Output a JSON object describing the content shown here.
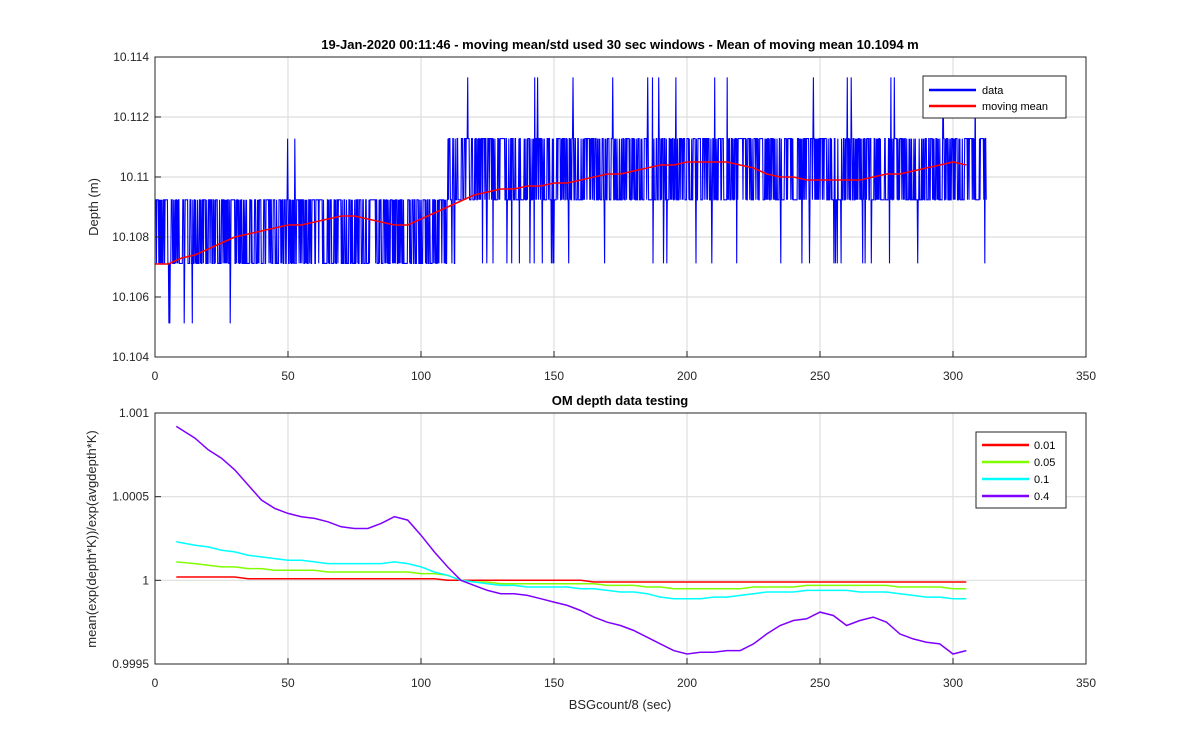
{
  "chart_data": [
    {
      "type": "line",
      "title": "19-Jan-2020 00:11:46 - moving mean/std used 30 sec windows - Mean of moving mean 10.1094 m",
      "xlabel": "",
      "ylabel": "Depth (m)",
      "xlim": [
        0,
        350
      ],
      "ylim": [
        10.104,
        10.114
      ],
      "xticks": [
        "0",
        "50",
        "100",
        "150",
        "200",
        "250",
        "300",
        "350"
      ],
      "yticks": [
        "10.104",
        "10.106",
        "10.108",
        "10.11",
        "10.112",
        "10.114"
      ],
      "grid": true,
      "legend_position": "top-right",
      "series": [
        {
          "name": "data",
          "color": "#0000ff",
          "style": "noisy",
          "x_range": [
            0,
            312.5
          ],
          "levels": [
            10.10512,
            10.10712,
            10.10924,
            10.11128,
            10.11332
          ],
          "note_levels_by_segment": [
            {
              "x": [
                0,
                30
              ],
              "low": 10.10712,
              "high": 10.10924,
              "dips_to": 10.10512
            },
            {
              "x": [
                30,
                110
              ],
              "low": 10.10712,
              "high": 10.10924,
              "spikes_to": 10.11128
            },
            {
              "x": [
                110,
                312.5
              ],
              "low": 10.10924,
              "high": 10.11128,
              "dips_to": 10.10712,
              "spikes_to": 10.11332
            }
          ]
        },
        {
          "name": "moving mean",
          "color": "#ff0000",
          "x": [
            0,
            5,
            10,
            15,
            20,
            25,
            30,
            35,
            40,
            45,
            50,
            55,
            60,
            65,
            70,
            75,
            80,
            85,
            90,
            95,
            100,
            105,
            110,
            115,
            120,
            125,
            130,
            135,
            140,
            145,
            150,
            155,
            160,
            165,
            170,
            175,
            180,
            185,
            190,
            195,
            200,
            205,
            210,
            215,
            220,
            225,
            230,
            235,
            240,
            245,
            250,
            255,
            260,
            265,
            270,
            275,
            280,
            285,
            290,
            295,
            300,
            305
          ],
          "values": [
            10.1071,
            10.1071,
            10.1073,
            10.1074,
            10.1076,
            10.1078,
            10.108,
            10.1081,
            10.1082,
            10.1083,
            10.1084,
            10.1084,
            10.1085,
            10.1086,
            10.1087,
            10.1087,
            10.1086,
            10.1085,
            10.1084,
            10.1084,
            10.1086,
            10.1088,
            10.109,
            10.1092,
            10.1094,
            10.1095,
            10.1096,
            10.1096,
            10.1097,
            10.1097,
            10.1098,
            10.1098,
            10.1099,
            10.11,
            10.1101,
            10.1101,
            10.1102,
            10.1103,
            10.1104,
            10.1104,
            10.1105,
            10.1105,
            10.1105,
            10.1105,
            10.1104,
            10.1103,
            10.1101,
            10.11,
            10.11,
            10.1099,
            10.1099,
            10.1099,
            10.1099,
            10.1099,
            10.11,
            10.1101,
            10.1101,
            10.1102,
            10.1103,
            10.1104,
            10.1105,
            10.1104
          ]
        }
      ]
    },
    {
      "type": "line",
      "title": "OM depth data testing",
      "xlabel": "BSGcount/8 (sec)",
      "ylabel": "mean(exp(depth*K))/exp(avgdepth*K)",
      "xlim": [
        0,
        350
      ],
      "ylim": [
        0.9995,
        1.001
      ],
      "xticks": [
        "0",
        "50",
        "100",
        "150",
        "200",
        "250",
        "300",
        "350"
      ],
      "yticks": [
        "0.9995",
        "1",
        "1.0005",
        "1.001"
      ],
      "grid": true,
      "legend_position": "top-right",
      "x": [
        8,
        15,
        20,
        25,
        30,
        35,
        40,
        45,
        50,
        55,
        60,
        65,
        70,
        75,
        80,
        85,
        90,
        95,
        100,
        105,
        110,
        115,
        120,
        125,
        130,
        135,
        140,
        145,
        150,
        155,
        160,
        165,
        170,
        175,
        180,
        185,
        190,
        195,
        200,
        205,
        210,
        215,
        220,
        225,
        230,
        235,
        240,
        245,
        250,
        255,
        260,
        265,
        270,
        275,
        280,
        285,
        290,
        295,
        300,
        305
      ],
      "series": [
        {
          "name": "0.01",
          "color": "#ff0000",
          "values": [
            1.00002,
            1.00002,
            1.00002,
            1.00002,
            1.00002,
            1.00001,
            1.00001,
            1.00001,
            1.00001,
            1.00001,
            1.00001,
            1.00001,
            1.00001,
            1.00001,
            1.00001,
            1.00001,
            1.00001,
            1.00001,
            1.00001,
            1.00001,
            1.0,
            1.0,
            1.0,
            1.0,
            1.0,
            1.0,
            1.0,
            1.0,
            1.0,
            1.0,
            1.0,
            0.99999,
            0.99999,
            0.99999,
            0.99999,
            0.99999,
            0.99999,
            0.99999,
            0.99999,
            0.99999,
            0.99999,
            0.99999,
            0.99999,
            0.99999,
            0.99999,
            0.99999,
            0.99999,
            0.99999,
            0.99999,
            0.99999,
            0.99999,
            0.99999,
            0.99999,
            0.99999,
            0.99999,
            0.99999,
            0.99999,
            0.99999,
            0.99999,
            0.99999
          ]
        },
        {
          "name": "0.05",
          "color": "#80ff00",
          "values": [
            1.00011,
            1.0001,
            1.00009,
            1.00008,
            1.00008,
            1.00007,
            1.00007,
            1.00006,
            1.00006,
            1.00006,
            1.00006,
            1.00005,
            1.00005,
            1.00005,
            1.00005,
            1.00005,
            1.00005,
            1.00005,
            1.00004,
            1.00004,
            1.00003,
            1.0,
            0.99999,
            0.99999,
            0.99998,
            0.99998,
            0.99998,
            0.99998,
            0.99998,
            0.99998,
            0.99998,
            0.99998,
            0.99997,
            0.99997,
            0.99997,
            0.99996,
            0.99996,
            0.99995,
            0.99995,
            0.99995,
            0.99995,
            0.99995,
            0.99995,
            0.99996,
            0.99996,
            0.99996,
            0.99996,
            0.99997,
            0.99997,
            0.99997,
            0.99997,
            0.99997,
            0.99997,
            0.99997,
            0.99996,
            0.99996,
            0.99996,
            0.99996,
            0.99995,
            0.99995
          ]
        },
        {
          "name": "0.1",
          "color": "#00ffff",
          "values": [
            1.00023,
            1.00021,
            1.0002,
            1.00018,
            1.00017,
            1.00015,
            1.00014,
            1.00013,
            1.00012,
            1.00012,
            1.00011,
            1.0001,
            1.0001,
            1.0001,
            1.0001,
            1.0001,
            1.00011,
            1.0001,
            1.00008,
            1.00005,
            1.00003,
            1.0,
            0.99999,
            0.99998,
            0.99997,
            0.99997,
            0.99996,
            0.99996,
            0.99996,
            0.99996,
            0.99995,
            0.99995,
            0.99994,
            0.99993,
            0.99993,
            0.99992,
            0.9999,
            0.99989,
            0.99989,
            0.99989,
            0.9999,
            0.9999,
            0.99991,
            0.99992,
            0.99993,
            0.99993,
            0.99993,
            0.99994,
            0.99994,
            0.99994,
            0.99994,
            0.99993,
            0.99993,
            0.99993,
            0.99992,
            0.99991,
            0.9999,
            0.9999,
            0.99989,
            0.99989
          ]
        },
        {
          "name": "0.4",
          "color": "#7f00ff",
          "values": [
            1.00092,
            1.00085,
            1.00078,
            1.00073,
            1.00066,
            1.00057,
            1.00048,
            1.00043,
            1.0004,
            1.00038,
            1.00037,
            1.00035,
            1.00032,
            1.00031,
            1.00031,
            1.00034,
            1.00038,
            1.00036,
            1.00027,
            1.00017,
            1.00008,
            1.0,
            0.99997,
            0.99994,
            0.99992,
            0.99992,
            0.99991,
            0.99989,
            0.99987,
            0.99985,
            0.99982,
            0.99978,
            0.99975,
            0.99973,
            0.9997,
            0.99966,
            0.99962,
            0.99958,
            0.99956,
            0.99957,
            0.99957,
            0.99958,
            0.99958,
            0.99962,
            0.99968,
            0.99973,
            0.99976,
            0.99977,
            0.99981,
            0.99979,
            0.99973,
            0.99976,
            0.99978,
            0.99975,
            0.99968,
            0.99965,
            0.99963,
            0.99962,
            0.99956,
            0.99958
          ]
        }
      ]
    }
  ]
}
